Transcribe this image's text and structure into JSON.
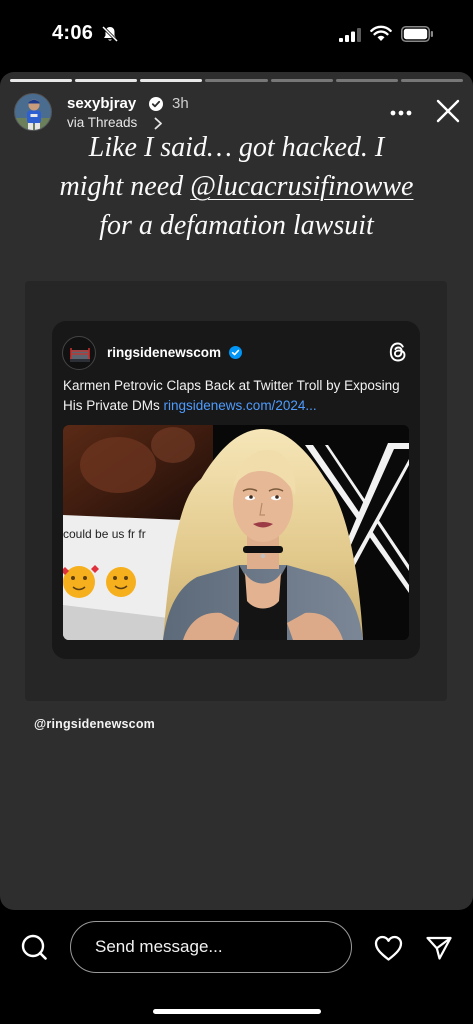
{
  "status_bar": {
    "time": "4:06"
  },
  "story": {
    "progress": {
      "total_segments": 7,
      "completed_segments": 3
    },
    "header": {
      "username": "sexybjray",
      "time_ago": "3h",
      "source": "via Threads"
    },
    "caption": {
      "line1": "Like I said… got hacked. I",
      "line2_prefix": "might need ",
      "mention": "@lucacrusifinowwe",
      "line3": "for a defamation lawsuit"
    },
    "threads_post": {
      "username": "ringsidenewscom",
      "text": "Karmen Petrovic Claps Back at Twitter Troll by Exposing His Private DMs ",
      "link": "ringsidenews.com/2024...",
      "image_text": "could be us fr fr"
    },
    "mention_sticker": "@ringsidenewscom"
  },
  "footer": {
    "message_placeholder": "Send message..."
  },
  "colors": {
    "accent_blue": "#4e9cff",
    "verified_blue": "#0095f6",
    "story_bg": "#2e2e2e"
  }
}
